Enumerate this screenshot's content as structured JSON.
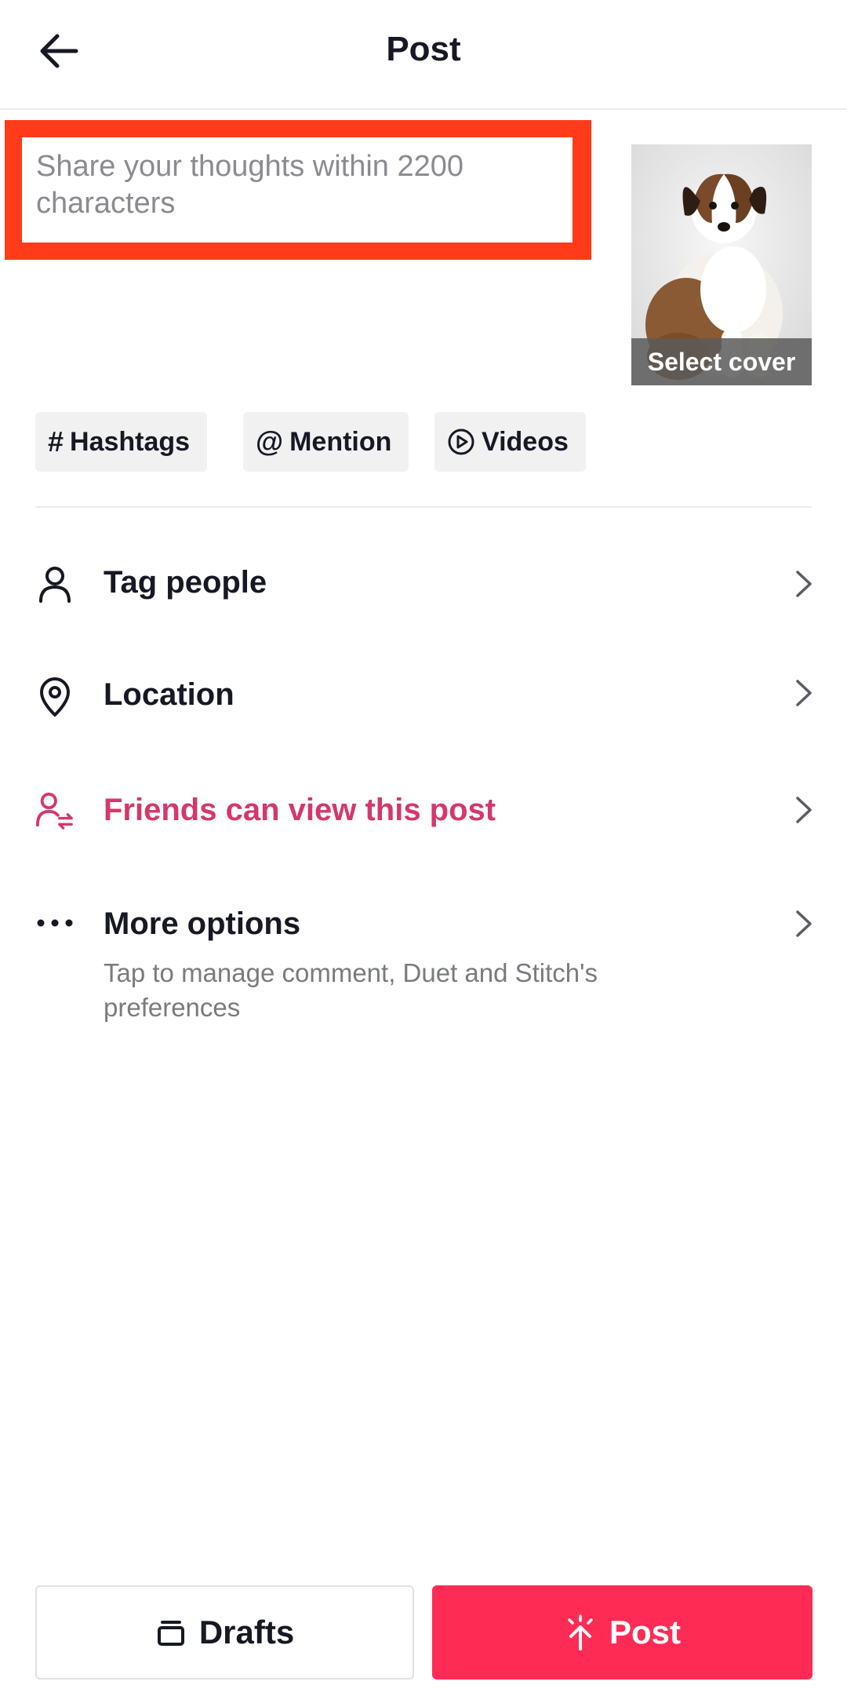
{
  "header": {
    "title": "Post",
    "back_icon": "arrow-left-icon"
  },
  "caption": {
    "placeholder": "Share your thoughts within 2200 characters",
    "value": ""
  },
  "cover": {
    "label": "Select cover",
    "image": "puppy-thumbnail"
  },
  "chips": [
    {
      "icon": "hashtag-icon",
      "label": "Hashtags"
    },
    {
      "icon": "at-icon",
      "label": "Mention"
    },
    {
      "icon": "play-circle-icon",
      "label": "Videos"
    }
  ],
  "options": [
    {
      "icon": "person-icon",
      "label": "Tag people"
    },
    {
      "icon": "location-pin-icon",
      "label": "Location"
    },
    {
      "icon": "friends-privacy-icon",
      "label": "Friends can view this post"
    },
    {
      "icon": "more-dots-icon",
      "label": "More options",
      "sub": "Tap to manage comment, Duet and Stitch's preferences"
    }
  ],
  "buttons": {
    "drafts": "Drafts",
    "post": "Post"
  },
  "colors": {
    "accent": "#fe2c55",
    "privacy_text": "#d4386b",
    "highlight_border": "#ff3b1a"
  }
}
